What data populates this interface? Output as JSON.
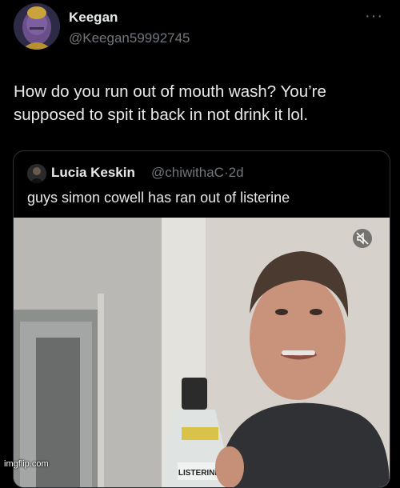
{
  "tweet": {
    "author_name": "Keegan",
    "author_handle": "@Keegan59992745",
    "more_icon": "more-horizontal-icon",
    "text": "How do you run out of mouth wash? You’re supposed to spit it back in not drink it lol."
  },
  "quote": {
    "author_name": "Lucia Keskin",
    "author_handle": "@chiwithaC",
    "separator": "·",
    "age": "2d",
    "text": "guys simon cowell has ran out of listerine",
    "media_icon": "sound-muted-icon",
    "bottle_label": "LISTERINE"
  },
  "watermark": "imgflip.com",
  "colors": {
    "background": "#000000",
    "text_primary": "#e7e9ea",
    "text_secondary": "#71767b",
    "border": "#2f3336"
  }
}
